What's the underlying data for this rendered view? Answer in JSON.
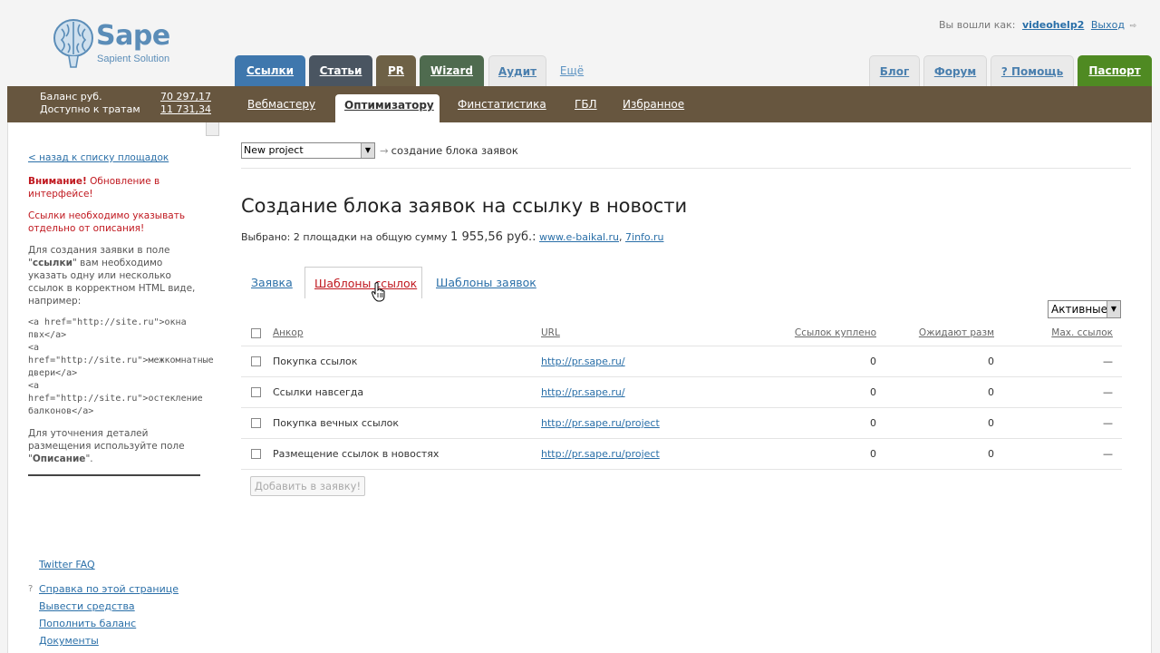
{
  "brand": {
    "name": "Sape",
    "tagline": "Sapient Solution"
  },
  "userbar": {
    "prefix": "Вы вошли как:",
    "username": "videohelp2",
    "logout": "Выход"
  },
  "top_tabs_left": [
    {
      "label": "Ссылки",
      "color": "#3f77ad"
    },
    {
      "label": "Статьи",
      "color": "#4a5561"
    },
    {
      "label": "PR",
      "color": "#6e6146"
    },
    {
      "label": "Wizard",
      "color": "#4f6b4f"
    },
    {
      "label": "Аудит"
    },
    {
      "label": "Ещё"
    }
  ],
  "top_tabs_right": [
    {
      "label": "Блог"
    },
    {
      "label": "Форум"
    },
    {
      "label": "? Помощь"
    },
    {
      "label": "Паспорт",
      "color": "#4f8a22"
    }
  ],
  "balance": {
    "balance_label": "Баланс   руб.",
    "balance_value": "70 297,17",
    "available_label": "Доступно к тратам",
    "available_value": "11 731,34"
  },
  "nav": {
    "items": [
      "Вебмастеру",
      "Оптимизатору",
      "Финстатистика",
      "ГБЛ",
      "Избранное"
    ],
    "active": "Оптимизатору"
  },
  "sidebar": {
    "back_link": "< назад к списку площадок",
    "warning_bold": "Внимание!",
    "warning_text": " Обновление в интерфейсе!",
    "warning2": "Ссылки необходимо указывать отдельно от описания!",
    "info_pre": "Для создания заявки в поле \"",
    "info_bold": "ссылки",
    "info_post": "\" вам необходимо указать одну или несколько ссылок в корректном HTML виде, например:",
    "code_lines": [
      "<a href=\"http://site.ru\">окна пвх</a>",
      "<a href=\"http://site.ru\">межкомнатные двери</a>",
      "<a href=\"http://site.ru\">остекление балконов</a>"
    ],
    "hint_pre": "Для уточнения деталей размещения используйте поле \"",
    "hint_bold": "Описание",
    "hint_post": "\".",
    "links": [
      "Twitter FAQ",
      "Справка по этой странице",
      "Вывести средства",
      "Пополнить баланс",
      "Документы"
    ]
  },
  "main": {
    "project_select": "New project",
    "crumb_arrow": "→",
    "crumb_text": "создание блока заявок",
    "title": "Создание блока заявок на ссылку в новости",
    "selected_prefix": "Выбрано: 2 площадки на общую сумму",
    "selected_sum": "1 955,56 руб.:",
    "site1": "www.e-baikal.ru",
    "site2": "7info.ru",
    "tabs": [
      "Заявка",
      "Шаблоны ссылок",
      "Шаблоны заявок"
    ],
    "active_tab": "Шаблоны ссылок",
    "filter_select": "Активные",
    "add_button": "Добавить в заявку!"
  },
  "table": {
    "headers": {
      "anchor": "Анкор",
      "url": "URL",
      "bought": "Ссылок куплено",
      "wait": "Ожидают разм",
      "max": "Мах. ссылок"
    },
    "rows": [
      {
        "anchor": "Покупка ссылок",
        "url": "http://pr.sape.ru/",
        "bought": "0",
        "wait": "0",
        "max": "—"
      },
      {
        "anchor": "Ссылки навсегда",
        "url": "http://pr.sape.ru/",
        "bought": "0",
        "wait": "0",
        "max": "—"
      },
      {
        "anchor": "Покупка вечных ссылок",
        "url": "http://pr.sape.ru/project",
        "bought": "0",
        "wait": "0",
        "max": "—"
      },
      {
        "anchor": "Размещение ссылок в новостях",
        "url": "http://pr.sape.ru/project",
        "bought": "0",
        "wait": "0",
        "max": "—"
      }
    ]
  },
  "colors": {
    "nav_brown": "#67563f",
    "link_blue": "#2a6fa8",
    "warning_red": "#c0181f",
    "passport_green": "#4f8a22"
  }
}
